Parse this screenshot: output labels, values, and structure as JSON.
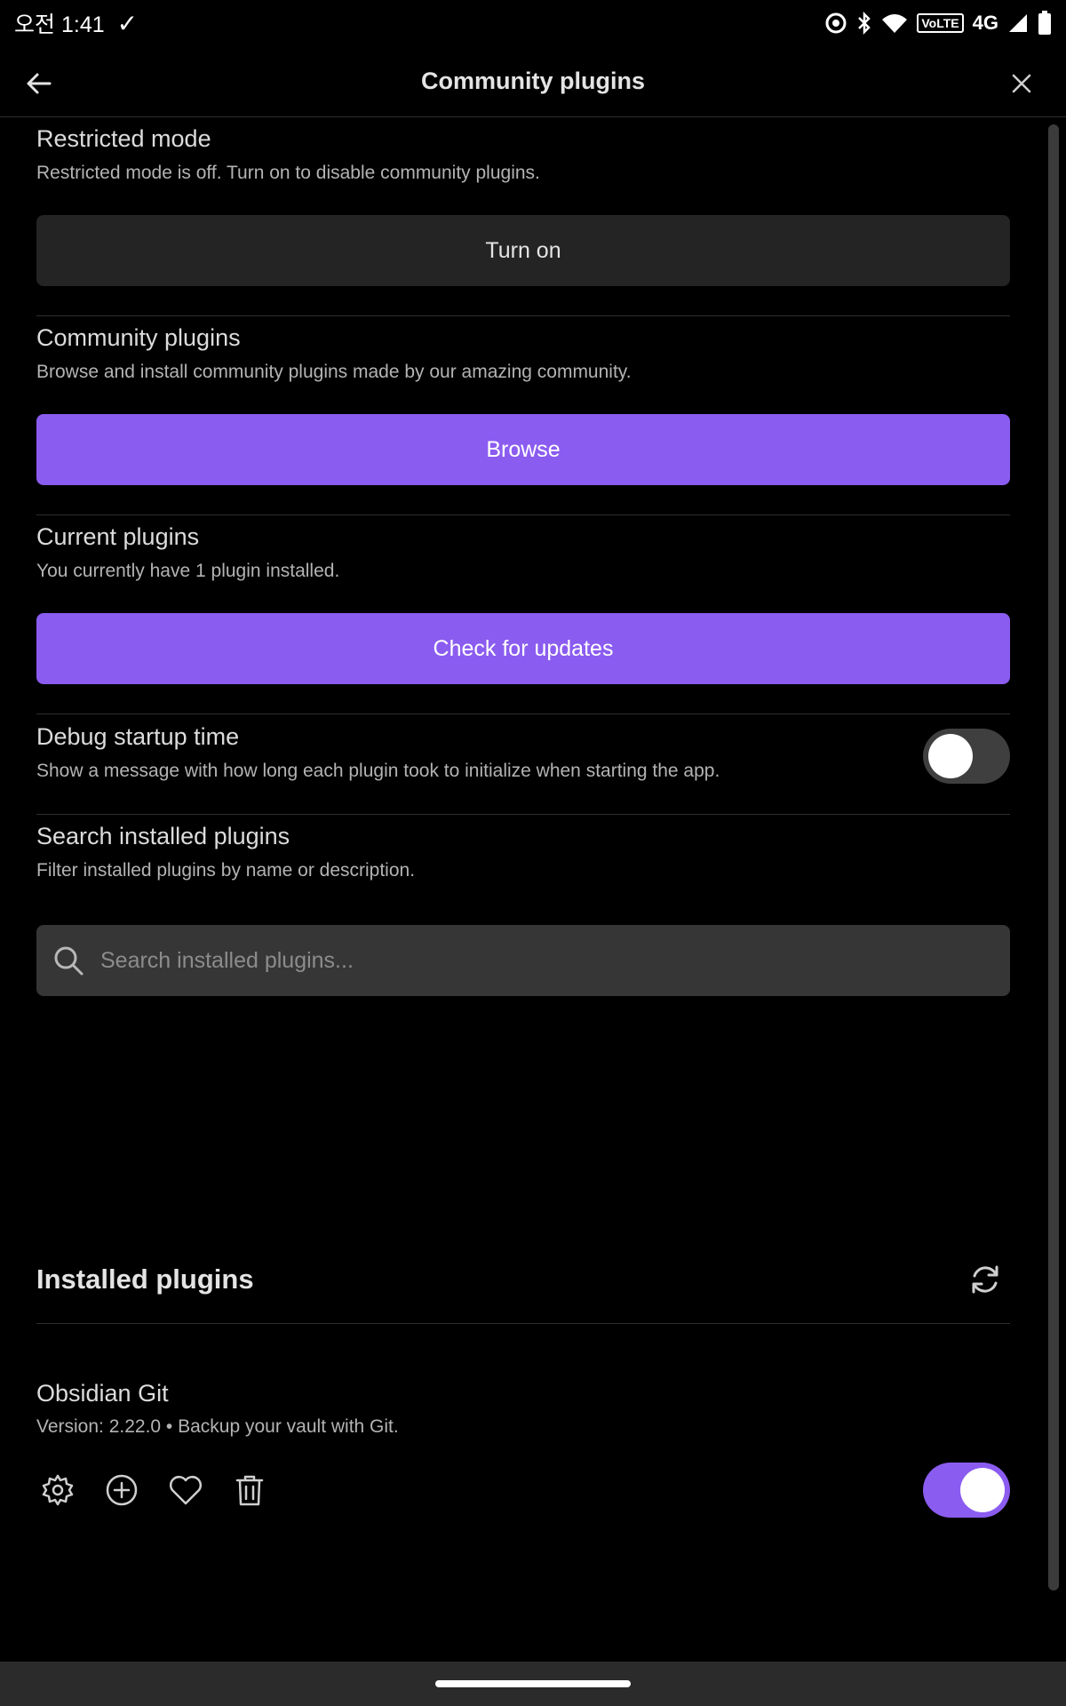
{
  "status_bar": {
    "ampm": "오전",
    "time": "1:41",
    "volte": "VoLTE",
    "network": "4G"
  },
  "header": {
    "title": "Community plugins"
  },
  "sections": {
    "restricted": {
      "title": "Restricted mode",
      "desc": "Restricted mode is off. Turn on to disable community plugins.",
      "button": "Turn on"
    },
    "community": {
      "title": "Community plugins",
      "desc": "Browse and install community plugins made by our amazing community.",
      "button": "Browse"
    },
    "current": {
      "title": "Current plugins",
      "desc": "You currently have 1 plugin installed.",
      "button": "Check for updates"
    },
    "debug": {
      "title": "Debug startup time",
      "desc": "Show a message with how long each plugin took to initialize when starting the app.",
      "enabled": false
    },
    "search": {
      "title": "Search installed plugins",
      "desc": "Filter installed plugins by name or description.",
      "placeholder": "Search installed plugins..."
    }
  },
  "installed": {
    "heading": "Installed plugins",
    "plugins": [
      {
        "name": "Obsidian Git",
        "meta": "Version: 2.22.0 • Backup your vault with Git.",
        "enabled": true
      }
    ]
  },
  "colors": {
    "accent": "#8b5cf0",
    "background": "#000000",
    "button_dark": "#242424"
  }
}
